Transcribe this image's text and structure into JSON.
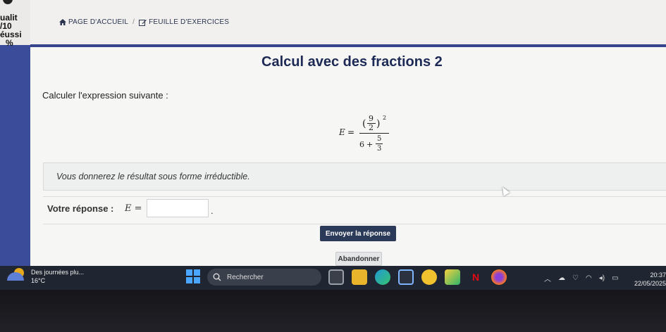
{
  "sidebar": {
    "lines": [
      "ualit",
      "/10",
      "éussi",
      "%"
    ]
  },
  "breadcrumb": {
    "home": "PAGE D'ACCUEIL",
    "separator": "/",
    "exercises": "FEUILLE D'EXERCICES"
  },
  "main": {
    "title": "Calcul avec des fractions 2",
    "instruction": "Calculer l'expression suivante :",
    "formula": {
      "lhs": "E",
      "eq": "=",
      "num_paren_open": "(",
      "num_top": "9",
      "num_bottom": "2",
      "num_paren_close": ")",
      "exponent": "2",
      "den_int": "6",
      "den_plus": "+",
      "den_top": "5",
      "den_bottom": "3"
    },
    "note": "Vous donnerez le résultat sous forme irréductible.",
    "answer_label": "Votre réponse :",
    "answer_var": "E =",
    "answer_value": "",
    "answer_suffix": ".",
    "submit_label": "Envoyer la réponse",
    "cancel_label": "Abandonner"
  },
  "taskbar": {
    "weather_text": "Des journées plu...",
    "weather_temp": "16°C",
    "search_label": "Rechercher",
    "time": "20:37",
    "date": "22/05/2025",
    "icons": [
      "start-icon",
      "search-icon",
      "media-app-icon",
      "file-explorer-icon",
      "edge-icon",
      "store-icon",
      "teams-icon",
      "paint-icon",
      "netflix-icon",
      "firefox-icon"
    ],
    "colors": {
      "taskbar_bg": "#202532",
      "accent": "#4aa6ff"
    }
  },
  "colors": {
    "primary": "#36448c",
    "title": "#1d2a55",
    "submit_bg": "#2b3a58"
  }
}
